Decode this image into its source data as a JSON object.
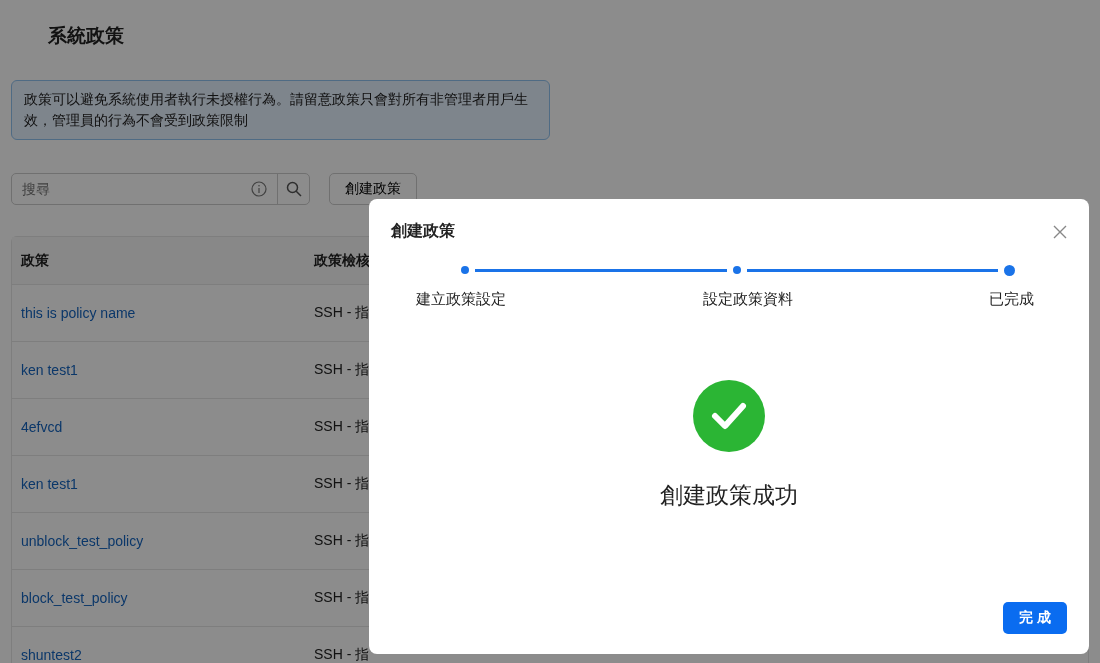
{
  "page": {
    "title": "系統政策",
    "notice": "政策可以避免系統使用者執行未授權行為。請留意政策只會對所有非管理者用戶生效，管理員的行為不會受到政策限制"
  },
  "toolbar": {
    "search": {
      "placeholder": "搜尋"
    },
    "create_button": "創建政策"
  },
  "table": {
    "columns": [
      "政策",
      "政策檢核"
    ],
    "rows": [
      {
        "name": "this is policy name",
        "check": "SSH - 指"
      },
      {
        "name": "ken test1",
        "check": "SSH - 指"
      },
      {
        "name": "4efvcd",
        "check": "SSH - 指"
      },
      {
        "name": "ken test1",
        "check": "SSH - 指"
      },
      {
        "name": "unblock_test_policy",
        "check": "SSH - 指"
      },
      {
        "name": "block_test_policy",
        "check": "SSH - 指"
      },
      {
        "name": "shuntest2",
        "check": "SSH - 指"
      }
    ]
  },
  "dialog": {
    "title": "創建政策",
    "steps": [
      {
        "label": "建立政策設定",
        "selected": false
      },
      {
        "label": "設定政策資料",
        "selected": false
      },
      {
        "label": "已完成",
        "selected": true
      }
    ],
    "message": "創建政策成功",
    "done_button": "完 成"
  }
}
